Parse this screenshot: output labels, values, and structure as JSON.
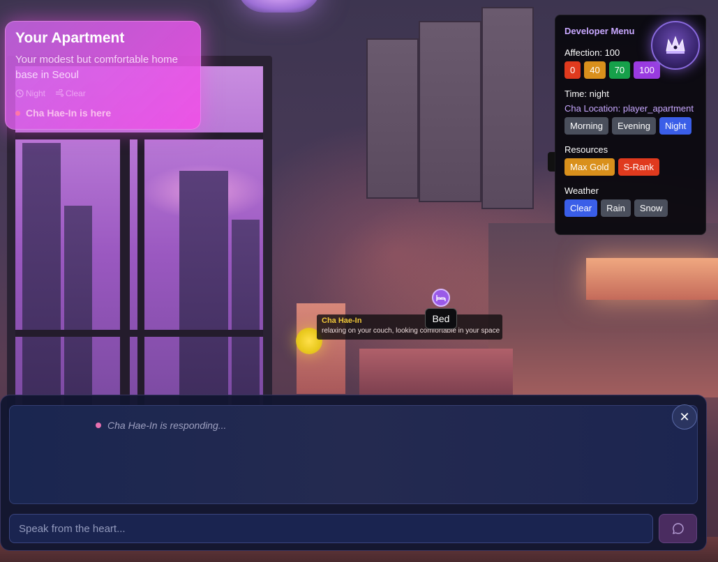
{
  "location": {
    "title": "Your Apartment",
    "description": "Your modest but comfortable home base in Seoul",
    "time": "Night",
    "weather": "Clear",
    "presence": "Cha Hae-In is here"
  },
  "dev_menu": {
    "title": "Developer Menu",
    "affection_label": "Affection: 100",
    "affection_buttons": [
      "0",
      "40",
      "70",
      "100"
    ],
    "time_label": "Time: night",
    "location_label": "Cha Location: player_apartment",
    "time_buttons": [
      "Morning",
      "Evening",
      "Night"
    ],
    "resources_label": "Resources",
    "resource_buttons": [
      "Max Gold",
      "S-Rank"
    ],
    "weather_label": "Weather",
    "weather_buttons": [
      "Clear",
      "Rain",
      "Snow"
    ]
  },
  "scene": {
    "hotspot_label": "Bed",
    "character_name": "Cha Hae-In",
    "character_status": "relaxing on your couch, looking comfortable in your space"
  },
  "chat": {
    "typing_text": "Cha Hae-In is responding...",
    "input_placeholder": "Speak from the heart...",
    "close_symbol": "✕"
  },
  "colors": {
    "accent_purple": "#c8a8ff",
    "card_pink": "#f050e6",
    "chat_bg": "#121630"
  }
}
